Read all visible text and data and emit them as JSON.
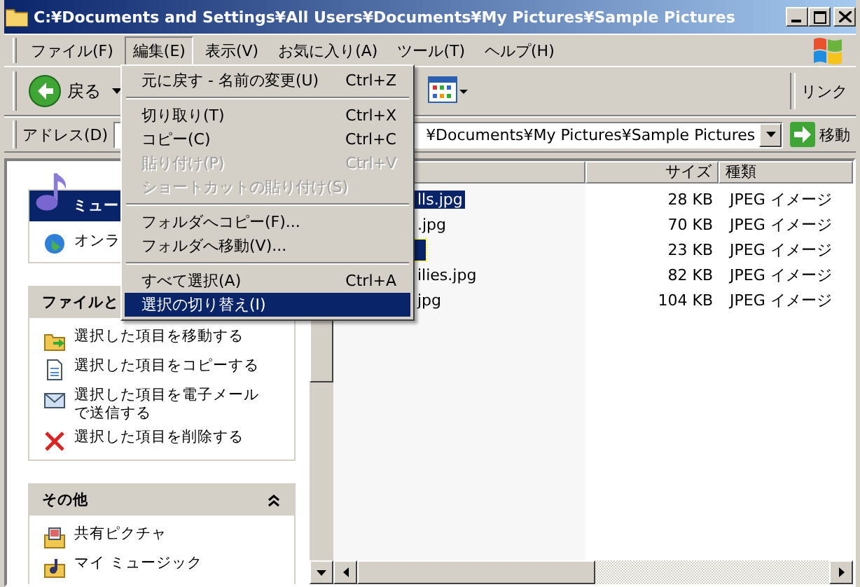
{
  "window": {
    "title": "C:¥Documents and Settings¥All Users¥Documents¥My Pictures¥Sample Pictures"
  },
  "menu_bar": [
    {
      "label": "ファイル(F)",
      "selected": false
    },
    {
      "label": "編集(E)",
      "selected": true
    },
    {
      "label": "表示(V)",
      "selected": false
    },
    {
      "label": "お気に入り(A)",
      "selected": false
    },
    {
      "label": "ツール(T)",
      "selected": false
    },
    {
      "label": "ヘルプ(H)",
      "selected": false
    }
  ],
  "toolbar": {
    "back_label": "戻る",
    "links_label": "リンク"
  },
  "address_bar": {
    "label": "アドレス(D)",
    "value": "¥Documents¥My Pictures¥Sample Pictures",
    "go_label": "移動"
  },
  "task_pane": {
    "music_box": {
      "title": "ミュー",
      "items": [
        "オンラ"
      ]
    },
    "file_tasks": {
      "title": "ファイルと",
      "items": [
        {
          "kind": "move",
          "label": "選択した項目を移動する"
        },
        {
          "kind": "copy",
          "label": "選択した項目をコピーする"
        },
        {
          "kind": "mail",
          "label": "選択した項目を電子メールで送信する"
        },
        {
          "kind": "delete",
          "label": "選択した項目を削除する"
        }
      ]
    },
    "other": {
      "title": "その他",
      "expanded": true,
      "items": [
        {
          "kind": "pictures",
          "label": "共有ピクチャ"
        },
        {
          "kind": "music",
          "label": "マイ ミュージック"
        }
      ]
    }
  },
  "file_list": {
    "columns": [
      "サイズ",
      "種類"
    ],
    "rows": [
      {
        "name": "lls.jpg",
        "size": "28 KB",
        "type": "JPEG イメージ",
        "selected": true
      },
      {
        "name": ".jpg",
        "size": "70 KB",
        "type": "JPEG イメージ",
        "selected": false
      },
      {
        "size": "23 KB",
        "type": "JPEG イメージ",
        "selected": true
      },
      {
        "name": "ilies.jpg",
        "size": "82 KB",
        "type": "JPEG イメージ",
        "selected": false
      },
      {
        "name": "jpg",
        "size": "104 KB",
        "type": "JPEG イメージ",
        "selected": false
      }
    ]
  },
  "edit_menu": {
    "items": [
      {
        "kind": "item",
        "label": "元に戻す - 名前の変更(U)",
        "shortcut": "Ctrl+Z",
        "disabled": false,
        "selected": false
      },
      {
        "kind": "separator"
      },
      {
        "kind": "item",
        "label": "切り取り(T)",
        "shortcut": "Ctrl+X",
        "disabled": false,
        "selected": false
      },
      {
        "kind": "item",
        "label": "コピー(C)",
        "shortcut": "Ctrl+C",
        "disabled": false,
        "selected": false
      },
      {
        "kind": "item",
        "label": "貼り付け(P)",
        "shortcut": "Ctrl+V",
        "disabled": true,
        "selected": false
      },
      {
        "kind": "item",
        "label": "ショートカットの貼り付け(S)",
        "disabled": true,
        "selected": false
      },
      {
        "kind": "separator"
      },
      {
        "kind": "item",
        "label": "フォルダへコピー(F)...",
        "disabled": false,
        "selected": false
      },
      {
        "kind": "item",
        "label": "フォルダへ移動(V)...",
        "disabled": false,
        "selected": false
      },
      {
        "kind": "separator"
      },
      {
        "kind": "item",
        "label": "すべて選択(A)",
        "shortcut": "Ctrl+A",
        "disabled": false,
        "selected": false
      },
      {
        "kind": "item",
        "label": "選択の切り替え(I)",
        "disabled": false,
        "selected": true
      }
    ]
  }
}
